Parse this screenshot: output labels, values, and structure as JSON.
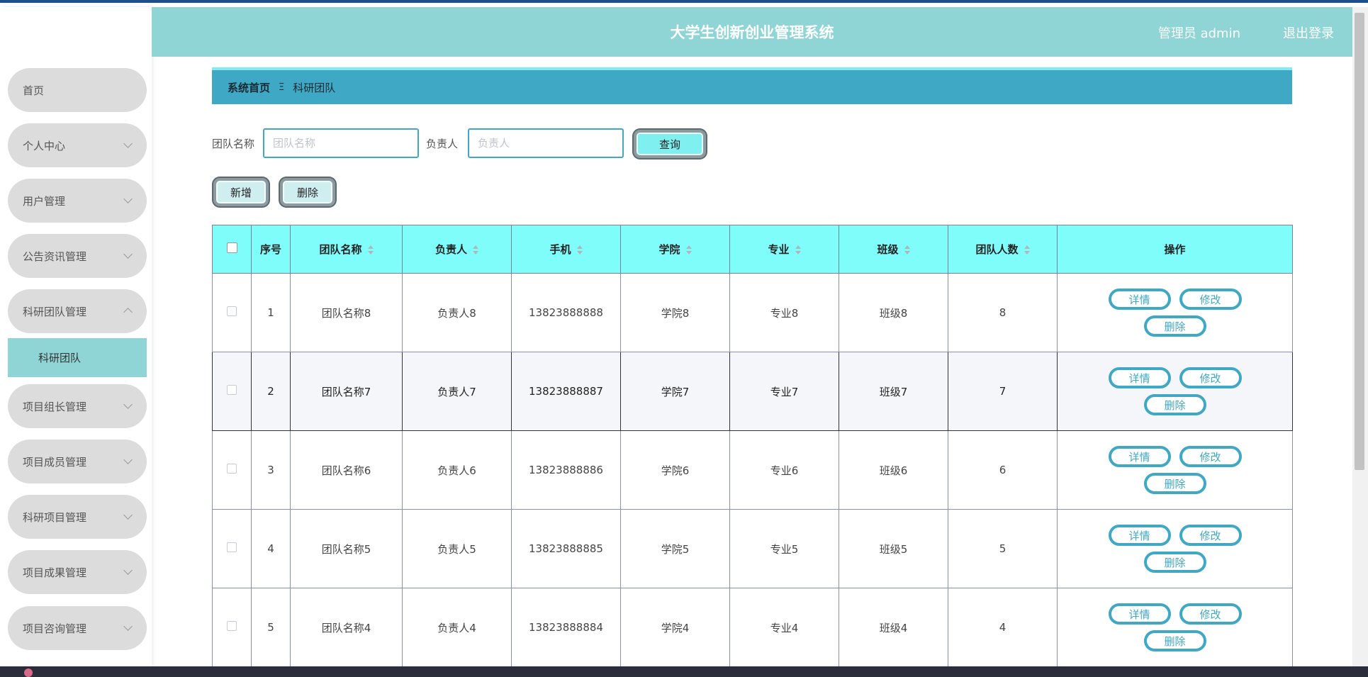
{
  "header": {
    "title": "大学生创新创业管理系统",
    "user": "管理员 admin",
    "logout": "退出登录"
  },
  "sidebar": {
    "items": [
      {
        "label": "首页"
      },
      {
        "label": "个人中心"
      },
      {
        "label": "用户管理"
      },
      {
        "label": "公告资讯管理"
      },
      {
        "label": "科研团队管理"
      },
      {
        "label": "项目组长管理"
      },
      {
        "label": "项目成员管理"
      },
      {
        "label": "科研项目管理"
      },
      {
        "label": "项目成果管理"
      },
      {
        "label": "项目咨询管理"
      }
    ],
    "sub_item": "科研团队"
  },
  "breadcrumb": {
    "home": "系统首页",
    "separator": "Ξ",
    "current": "科研团队"
  },
  "search": {
    "team_label": "团队名称",
    "team_placeholder": "团队名称",
    "leader_label": "负责人",
    "leader_placeholder": "负责人",
    "query_button": "查询"
  },
  "toolbar": {
    "add_button": "新增",
    "delete_button": "删除"
  },
  "table": {
    "headers": [
      "序号",
      "团队名称",
      "负责人",
      "手机",
      "学院",
      "专业",
      "班级",
      "团队人数",
      "操作"
    ],
    "rows": [
      {
        "no": "1",
        "team": "团队名称8",
        "leader": "负责人8",
        "phone": "13823888888",
        "college": "学院8",
        "major": "专业8",
        "class": "班级8",
        "count": "8"
      },
      {
        "no": "2",
        "team": "团队名称7",
        "leader": "负责人7",
        "phone": "13823888887",
        "college": "学院7",
        "major": "专业7",
        "class": "班级7",
        "count": "7"
      },
      {
        "no": "3",
        "team": "团队名称6",
        "leader": "负责人6",
        "phone": "13823888886",
        "college": "学院6",
        "major": "专业6",
        "class": "班级6",
        "count": "6"
      },
      {
        "no": "4",
        "team": "团队名称5",
        "leader": "负责人5",
        "phone": "13823888885",
        "college": "学院5",
        "major": "专业5",
        "class": "班级5",
        "count": "5"
      },
      {
        "no": "5",
        "team": "团队名称4",
        "leader": "负责人4",
        "phone": "13823888884",
        "college": "学院4",
        "major": "专业4",
        "class": "班级4",
        "count": "4"
      }
    ],
    "ops": {
      "detail": "详情",
      "edit": "修改",
      "delete": "删除"
    }
  },
  "colors": {
    "header_bg": "#8fd5d5",
    "breadcrumb_bg": "#3fa8c4",
    "table_header_bg": "#7ffdfb",
    "accent": "#3fa8c4",
    "menu_bg": "#dcdcdc"
  }
}
